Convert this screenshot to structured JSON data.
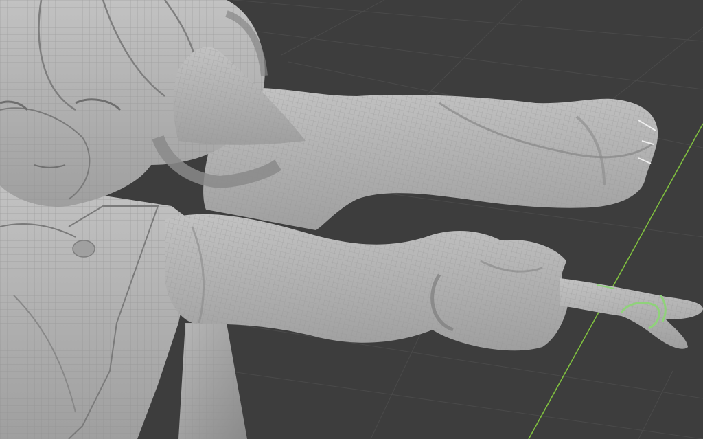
{
  "viewport": {
    "background": "#3d3d3d",
    "grid_color": "#4a4a4a",
    "axis_x_color": "#7fbf3f",
    "mesh_base_color": "#b3b3b3",
    "mesh_shadow_color": "#8d8d8d",
    "wire_color": "#9a9a9a",
    "selection_color": "#8fd27a"
  },
  "model": {
    "render_mode": "solid-wireframe",
    "parts": [
      "hair",
      "horn",
      "face",
      "torso-jacket",
      "upper-arm",
      "lower-arm",
      "hand",
      "extended-finger"
    ]
  }
}
